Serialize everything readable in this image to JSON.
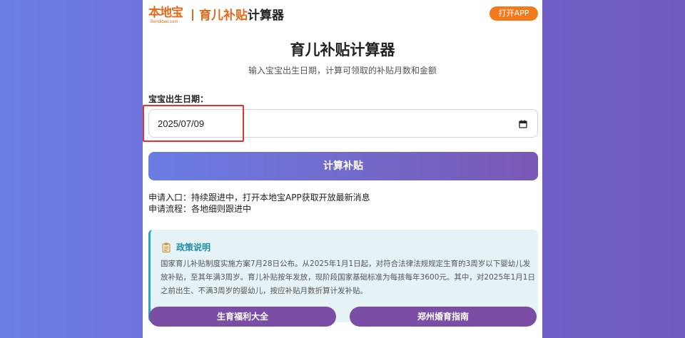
{
  "header": {
    "logo_cn": "本地宝",
    "logo_en": "Bendibao.com",
    "title_highlight": "育儿补贴",
    "title_rest": "计算器",
    "open_app_label": "打开APP"
  },
  "main": {
    "title": "育儿补贴计算器",
    "subtitle": "输入宝宝出生日期，计算可领取的补贴月数和金额",
    "date_label": "宝宝出生日期：",
    "date_value": "2025/07/09",
    "calc_button_label": "计算补贴",
    "info_line_1": "申请入口：持续跟进中，打开本地宝APP获取开放最新消息",
    "info_line_2": "申请流程：各地细则跟进中"
  },
  "policy": {
    "title": "政策说明",
    "text": "国家育儿补贴制度实施方案7月28日公布。从2025年1月1日起，对符合法律法规规定生育的3周岁以下婴幼儿发放补贴，至其年满3周岁。育儿补贴按年发放，现阶段国家基础标准为每孩每年3600元。其中，对2025年1月1日之前出生、不满3周岁的婴幼儿，按应补贴月数折算计发补贴。"
  },
  "footer": {
    "left_button": "生育福利大全",
    "right_button": "郑州婚育指南"
  },
  "colors": {
    "brand_orange": "#f27a1a",
    "gradient_start": "#6a7de3",
    "gradient_end": "#7a58b5",
    "purple_button": "#7b4ea6",
    "policy_accent": "#2aa7c0",
    "highlight_red": "#e53030"
  },
  "icons": {
    "date_picker": "calendar-icon",
    "policy": "clipboard-icon"
  }
}
